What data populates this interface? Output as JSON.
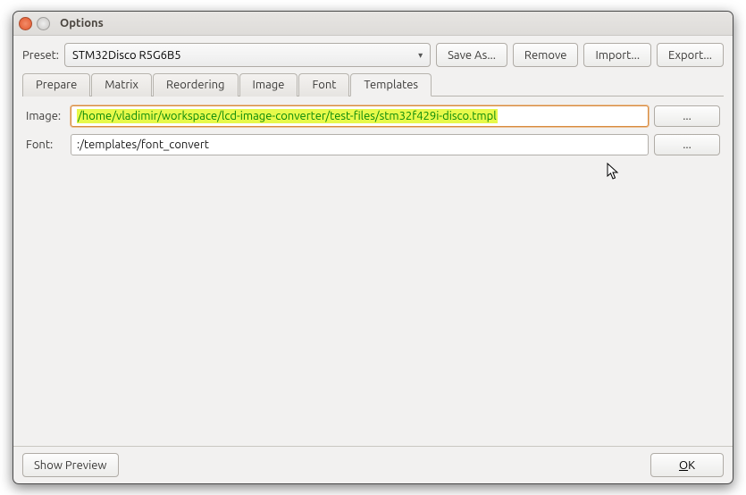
{
  "window": {
    "title": "Options"
  },
  "preset": {
    "label": "Preset:",
    "selected": "STM32Disco R5G6B5",
    "buttons": {
      "saveAs": "Save As...",
      "remove": "Remove",
      "import": "Import...",
      "export": "Export..."
    }
  },
  "tabs": {
    "prepare": "Prepare",
    "matrix": "Matrix",
    "reordering": "Reordering",
    "image": "Image",
    "font": "Font",
    "templates": "Templates"
  },
  "templates": {
    "imageLabel": "Image:",
    "imageValue": "/home/vladimir/workspace/lcd-image-converter/test-files/stm32f429i-disco.tmpl",
    "fontLabel": "Font:",
    "fontValue": ":/templates/font_convert",
    "browse": "..."
  },
  "bottom": {
    "showPreview": "Show Preview",
    "okPrefix": "O",
    "okSuffix": "K"
  }
}
